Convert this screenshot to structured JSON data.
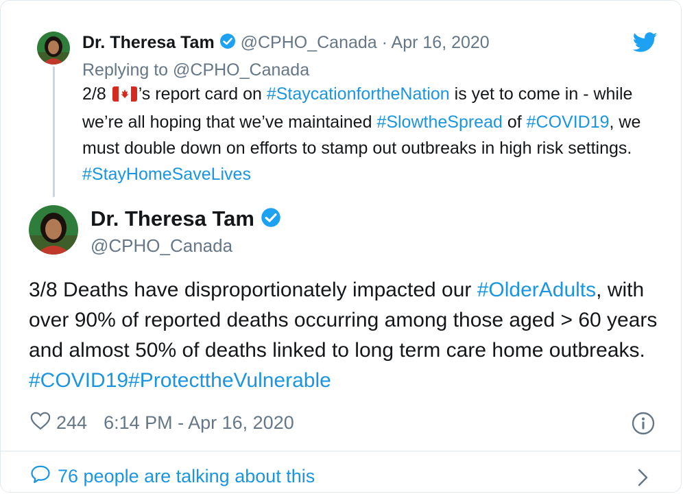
{
  "reply_tweet": {
    "author_name": "Dr. Theresa Tam",
    "handle": "@CPHO_Canada",
    "separator": "·",
    "date": "Apr 16, 2020",
    "replying_to": "Replying to @CPHO_Canada",
    "body": {
      "p1": "2/8 ",
      "p2": "’s report card on ",
      "tag1": "#StaycationfortheNation",
      "p3": " is yet to come in - while we’re all hoping that we’ve maintained ",
      "tag2": "#SlowtheSpread",
      "p4": " of ",
      "tag3": "#COVID19",
      "p5": ", we must double down on efforts to stamp out outbreaks in high risk settings. ",
      "tag4": "#StayHomeSaveLives"
    }
  },
  "main_tweet": {
    "author_name": "Dr. Theresa Tam",
    "handle": "@CPHO_Canada",
    "body": {
      "p1": "3/8 Deaths have disproportionately impacted our ",
      "tag1": "#OlderAdults",
      "p2": ", with over 90% of reported deaths occurring among those aged > 60 years and almost 50% of deaths linked to long term care home outbreaks. ",
      "tag2": "#COVID19",
      "tag3": "#ProtecttheVulnerable"
    },
    "likes": "244",
    "timestamp": "6:14 PM - Apr 16, 2020"
  },
  "footer": {
    "talking": "76 people are talking about this"
  },
  "icons": {
    "verified": "verified-badge-icon",
    "twitter": "twitter-bird-icon",
    "heart": "heart-icon",
    "info": "info-icon",
    "comment": "speech-bubble-icon",
    "chevron": "chevron-right-icon",
    "flag": "canada-flag-emoji"
  },
  "colors": {
    "link": "#1b95e0",
    "muted": "#657786",
    "text": "#14171a",
    "twitter_blue": "#1da1f2"
  }
}
